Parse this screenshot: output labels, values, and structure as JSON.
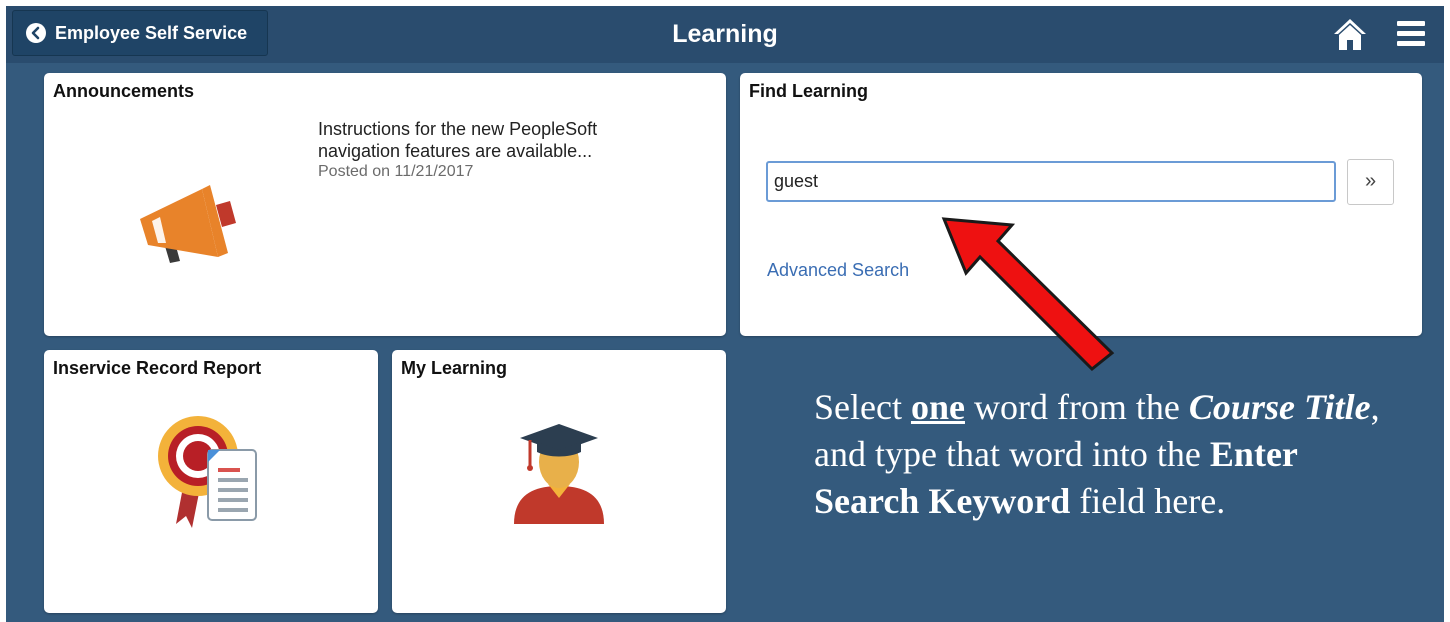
{
  "header": {
    "back_label": "Employee Self Service",
    "title": "Learning"
  },
  "tiles": {
    "announcements": {
      "title": "Announcements",
      "message": "Instructions for the new   PeopleSoft navigation features are available...",
      "posted": "Posted on 11/21/2017"
    },
    "find_learning": {
      "title": "Find Learning",
      "search_value": "guest",
      "go_label": "»",
      "advanced_label": "Advanced Search"
    },
    "inservice": {
      "title": "Inservice Record Report"
    },
    "my_learning": {
      "title": "My Learning"
    }
  },
  "instruction": {
    "part1": "Select ",
    "one": "one",
    "part2": " word from the ",
    "course_title": "Course Title",
    "part3": ", and type that word into the ",
    "field_name": "Enter Search Keyword",
    "part4": " field here."
  },
  "icons": {
    "back": "chevron-left-icon",
    "home": "home-icon",
    "menu": "hamburger-menu-icon",
    "announcements": "megaphone-icon",
    "inservice": "award-ribbon-document-icon",
    "my_learning": "graduate-icon",
    "annotation": "red-arrow-icon"
  },
  "colors": {
    "background": "#345a7d",
    "header": "#2a4c6e",
    "link": "#3a6db3",
    "input_border": "#6b9bd6",
    "arrow": "#ee1111"
  }
}
